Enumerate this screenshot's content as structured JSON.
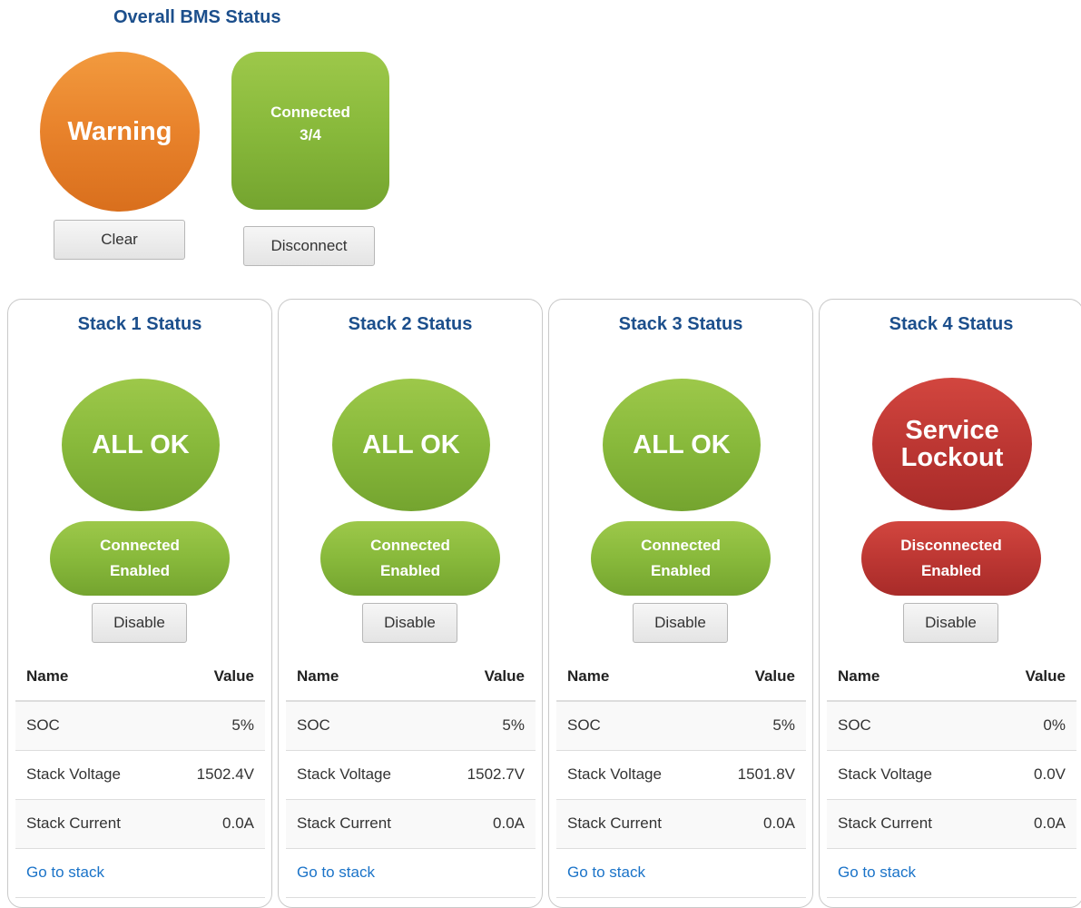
{
  "overall": {
    "title": "Overall BMS Status",
    "warning_label": "Warning",
    "connection_line1": "Connected",
    "connection_line2": "3/4",
    "clear_label": "Clear",
    "disconnect_label": "Disconnect",
    "colors": {
      "warning": "#e8822b",
      "connected": "#88b93b",
      "title": "#1c4f8c"
    }
  },
  "table_headers": {
    "name": "Name",
    "value": "Value"
  },
  "stacks": [
    {
      "title": "Stack 1 Status",
      "status": "ALL OK",
      "status_color": "#88b93b",
      "connection": "Connected",
      "enabled": "Enabled",
      "disable_label": "Disable",
      "rows": [
        {
          "name": "SOC",
          "value": "5%"
        },
        {
          "name": "Stack Voltage",
          "value": "1502.4V"
        },
        {
          "name": "Stack Current",
          "value": "0.0A"
        }
      ],
      "link": "Go to stack"
    },
    {
      "title": "Stack 2 Status",
      "status": "ALL OK",
      "status_color": "#88b93b",
      "connection": "Connected",
      "enabled": "Enabled",
      "disable_label": "Disable",
      "rows": [
        {
          "name": "SOC",
          "value": "5%"
        },
        {
          "name": "Stack Voltage",
          "value": "1502.7V"
        },
        {
          "name": "Stack Current",
          "value": "0.0A"
        }
      ],
      "link": "Go to stack"
    },
    {
      "title": "Stack 3 Status",
      "status": "ALL OK",
      "status_color": "#88b93b",
      "connection": "Connected",
      "enabled": "Enabled",
      "disable_label": "Disable",
      "rows": [
        {
          "name": "SOC",
          "value": "5%"
        },
        {
          "name": "Stack Voltage",
          "value": "1501.8V"
        },
        {
          "name": "Stack Current",
          "value": "0.0A"
        }
      ],
      "link": "Go to stack"
    },
    {
      "title": "Stack 4 Status",
      "status": "Service\nLockout",
      "status_color": "#bd3733",
      "connection": "Disconnected",
      "enabled": "Enabled",
      "disable_label": "Disable",
      "rows": [
        {
          "name": "SOC",
          "value": "0%"
        },
        {
          "name": "Stack Voltage",
          "value": "0.0V"
        },
        {
          "name": "Stack Current",
          "value": "0.0A"
        }
      ],
      "link": "Go to stack"
    }
  ]
}
